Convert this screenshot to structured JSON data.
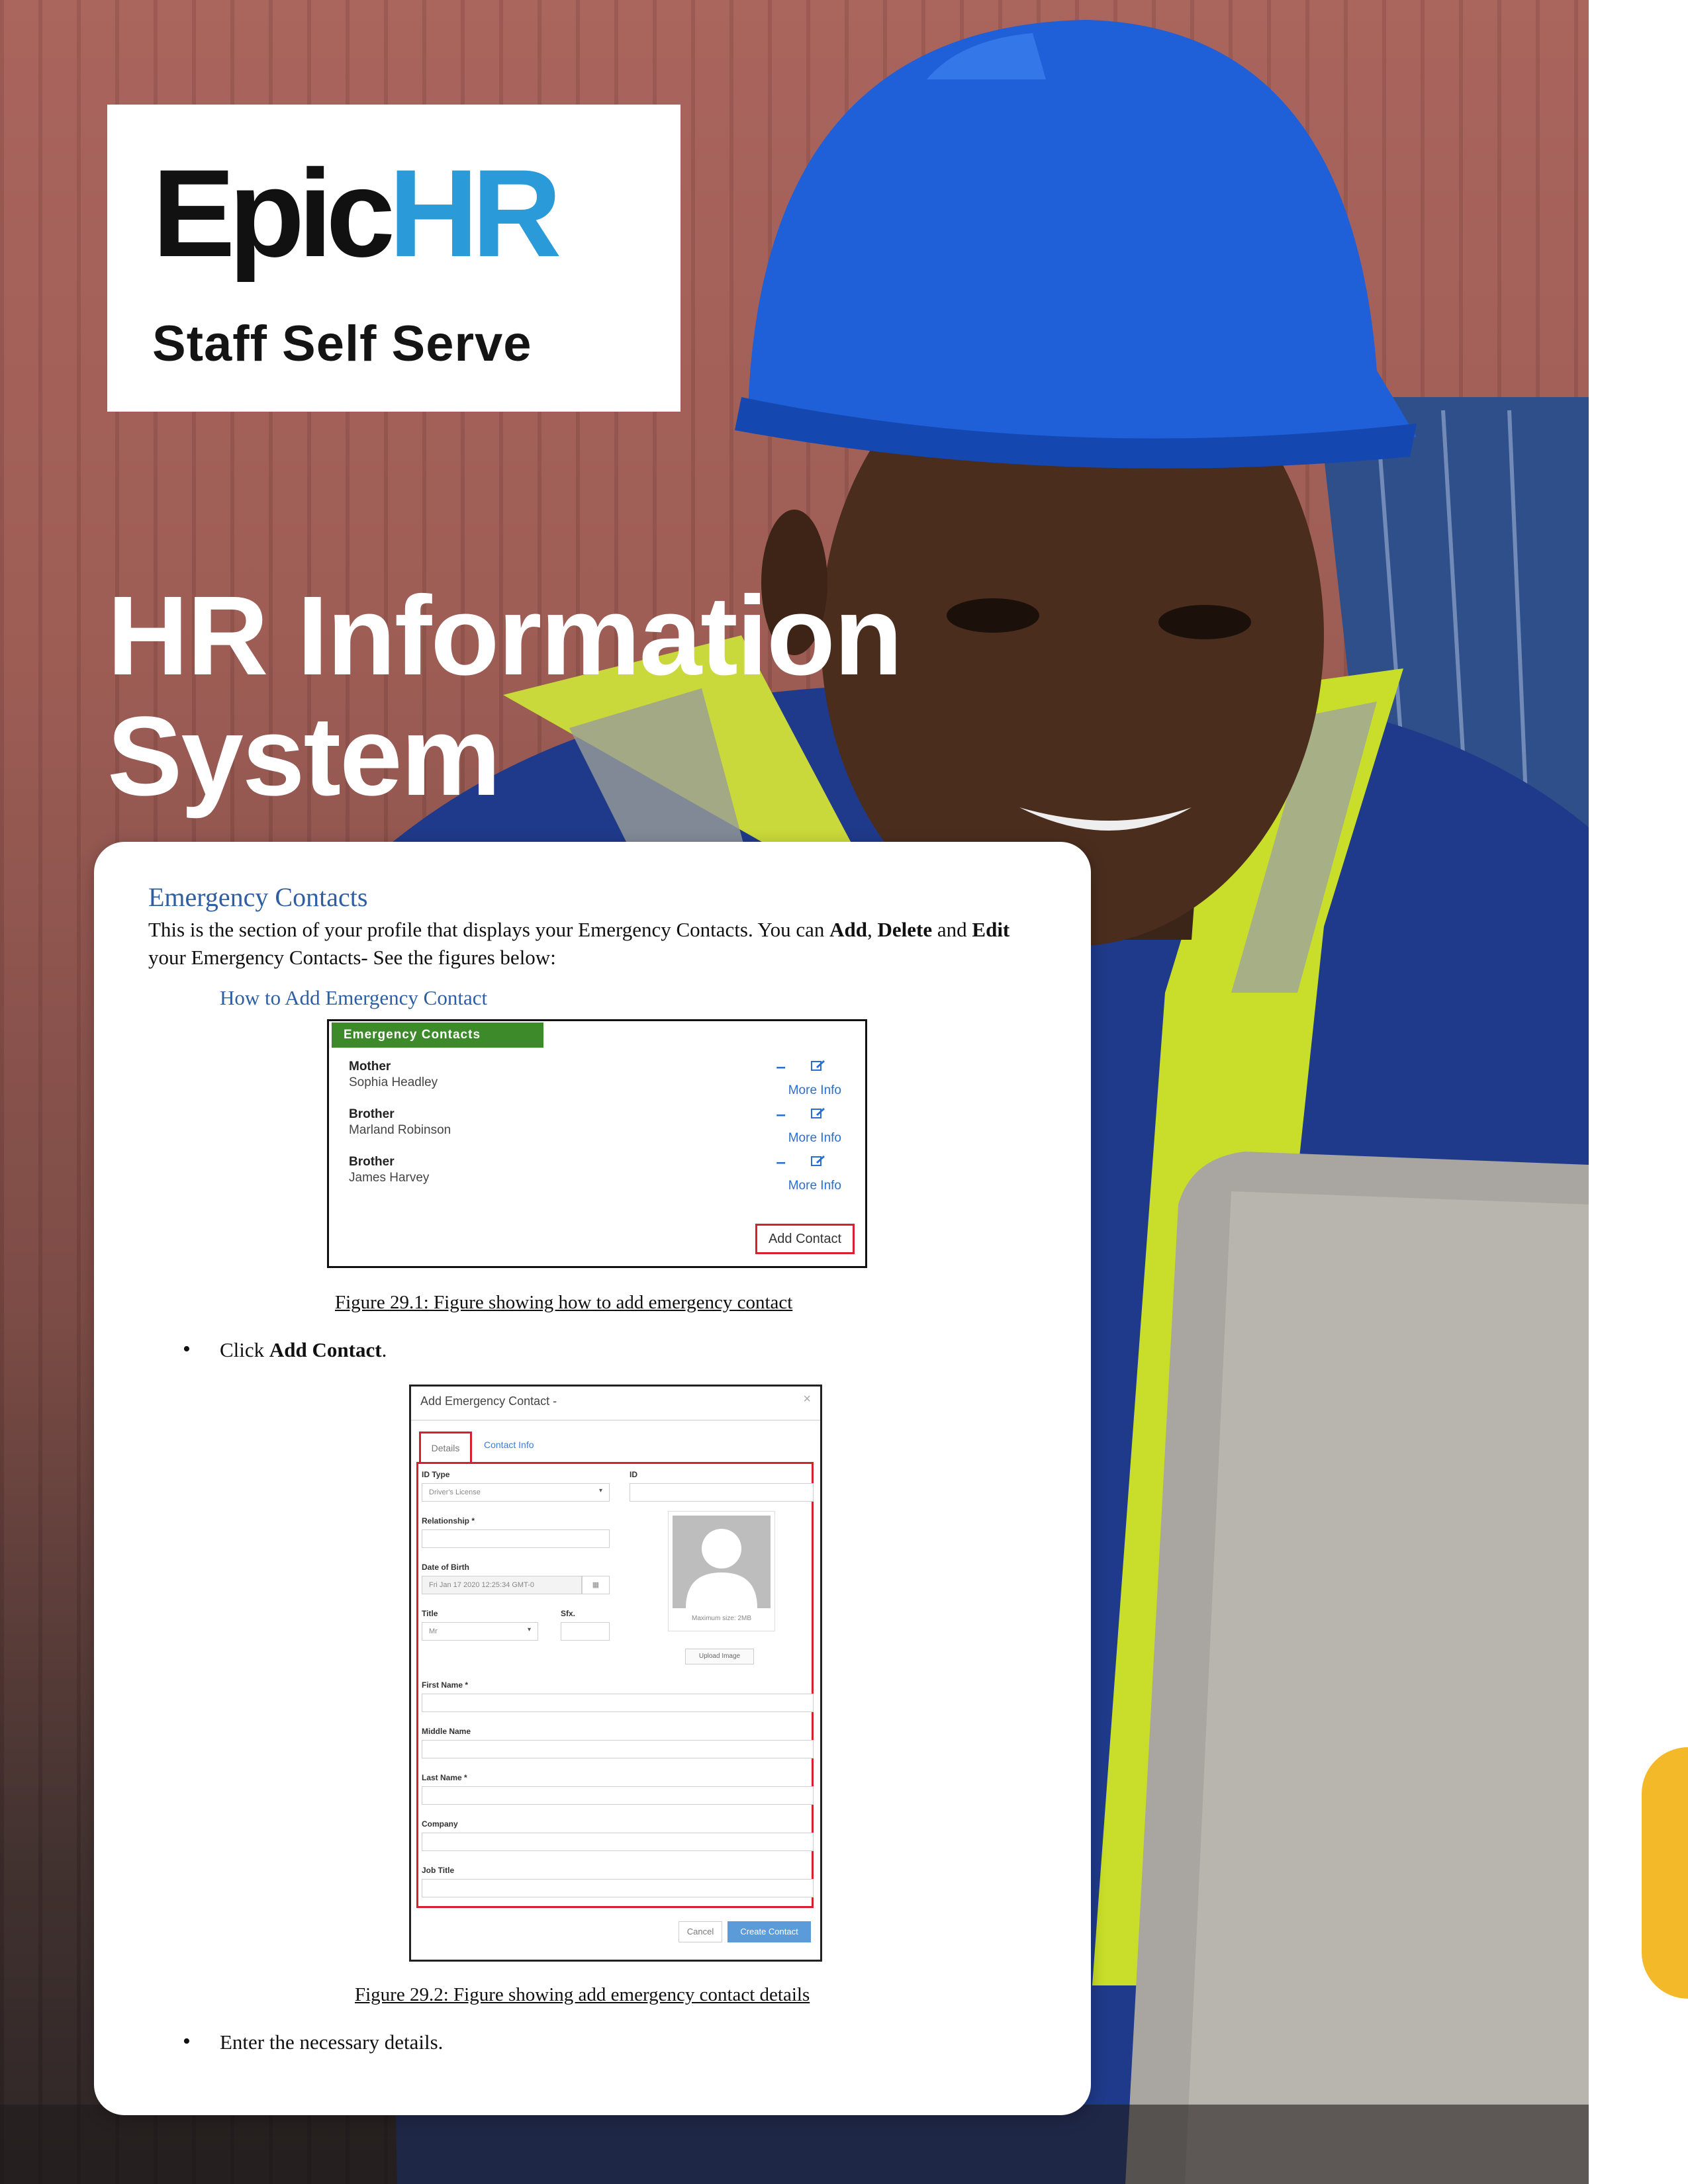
{
  "brand": {
    "name_part1": "Epic",
    "name_part2": "HR",
    "tagline": "Staff Self Serve",
    "colors": {
      "dark": "#111111",
      "blue": "#2b9ad8"
    }
  },
  "hero": {
    "title_line1": "HR Information",
    "title_line2": "System"
  },
  "document": {
    "heading": "Emergency Contacts",
    "paragraph_part1": "This is the section of your profile that displays your Emergency Contacts. You can ",
    "paragraph_add": "Add",
    "paragraph_sep1": ", ",
    "paragraph_delete": "Delete",
    "paragraph_sep2": " and ",
    "paragraph_edit": "Edit",
    "paragraph_part2": " your Emergency Contacts- See the figures below:",
    "subheading": "How to Add Emergency Contact",
    "figure1": {
      "header": "Emergency Contacts",
      "contacts": [
        {
          "relationship": "Mother",
          "name": "Sophia Headley",
          "more": "More Info"
        },
        {
          "relationship": "Brother",
          "name": "Marland Robinson",
          "more": "More Info"
        },
        {
          "relationship": "Brother",
          "name": "James Harvey",
          "more": "More Info"
        }
      ],
      "add_button": "Add Contact",
      "caption": "Figure 29.1: Figure showing how to add emergency contact"
    },
    "bullet1_prefix": "Click ",
    "bullet1_bold": "Add Contact",
    "bullet1_suffix": ".",
    "figure2": {
      "title": "Add Emergency Contact -",
      "close": "×",
      "tabs": [
        "Details",
        "Contact Info"
      ],
      "fields": {
        "id_type_label": "ID Type",
        "id_type_value": "Driver's License",
        "id_label": "ID",
        "relationship_label": "Relationship *",
        "dob_label": "Date of Birth",
        "dob_value": "Fri Jan 17 2020 12:25:34 GMT-0",
        "title_label": "Title",
        "title_value": "Mr",
        "sfx_label": "Sfx.",
        "first_name_label": "First Name *",
        "middle_name_label": "Middle Name",
        "last_name_label": "Last Name *",
        "company_label": "Company",
        "job_title_label": "Job Title"
      },
      "photo_caption": "Maximum size: 2MB",
      "upload_button": "Upload Image",
      "cancel_button": "Cancel",
      "create_button": "Create Contact",
      "caption": "Figure 29.2: Figure showing add emergency contact details"
    },
    "bullet2": "Enter the necessary details."
  }
}
